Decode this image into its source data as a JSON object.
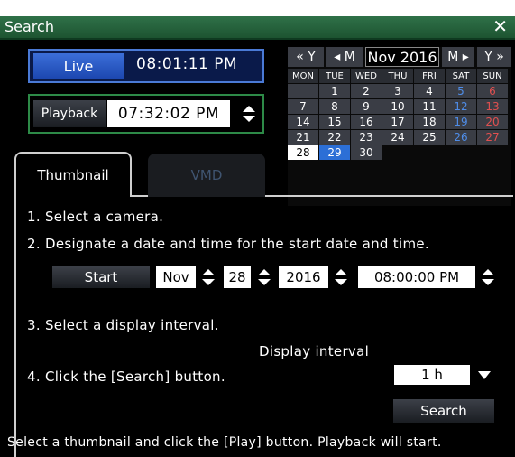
{
  "dialog": {
    "title": "Search",
    "close_symbol": "✕"
  },
  "live": {
    "label": "Live",
    "time": "08:01:11 PM"
  },
  "playback": {
    "label": "Playback",
    "time": "07:32:02 PM"
  },
  "calendar": {
    "nav": {
      "prev_year": "« Y",
      "prev_month": "◂ M",
      "month_year": "Nov 2016",
      "next_month": "M ▸",
      "next_year": "Y »"
    },
    "weekdays": [
      "MON",
      "TUE",
      "WED",
      "THU",
      "FRI",
      "SAT",
      "SUN"
    ],
    "weeks": [
      [
        "",
        "1",
        "2",
        "3",
        "4",
        "5",
        "6"
      ],
      [
        "7",
        "8",
        "9",
        "10",
        "11",
        "12",
        "13"
      ],
      [
        "14",
        "15",
        "16",
        "17",
        "18",
        "19",
        "20"
      ],
      [
        "21",
        "22",
        "23",
        "24",
        "25",
        "26",
        "27"
      ],
      [
        "28",
        "29",
        "30",
        "",
        "",
        "",
        ""
      ],
      [
        "",
        "",
        "",
        "",
        "",
        "",
        ""
      ]
    ],
    "selected_day": "29",
    "available_day": "28"
  },
  "tabs": {
    "thumbnail": "Thumbnail",
    "vmd": "VMD"
  },
  "steps": {
    "step1": "1. Select a camera.",
    "step2": "2. Designate a date and time for the start date and time.",
    "step3": "3. Select a display interval.",
    "step4": "4. Click the [Search] button."
  },
  "start": {
    "button": "Start",
    "month": "Nov",
    "day": "28",
    "year": "2016",
    "time": "08:00:00 PM"
  },
  "interval": {
    "label": "Display interval",
    "value": "1 h"
  },
  "search_button": "Search",
  "footer": "Select a thumbnail and click the [Play] button. Playback will start."
}
